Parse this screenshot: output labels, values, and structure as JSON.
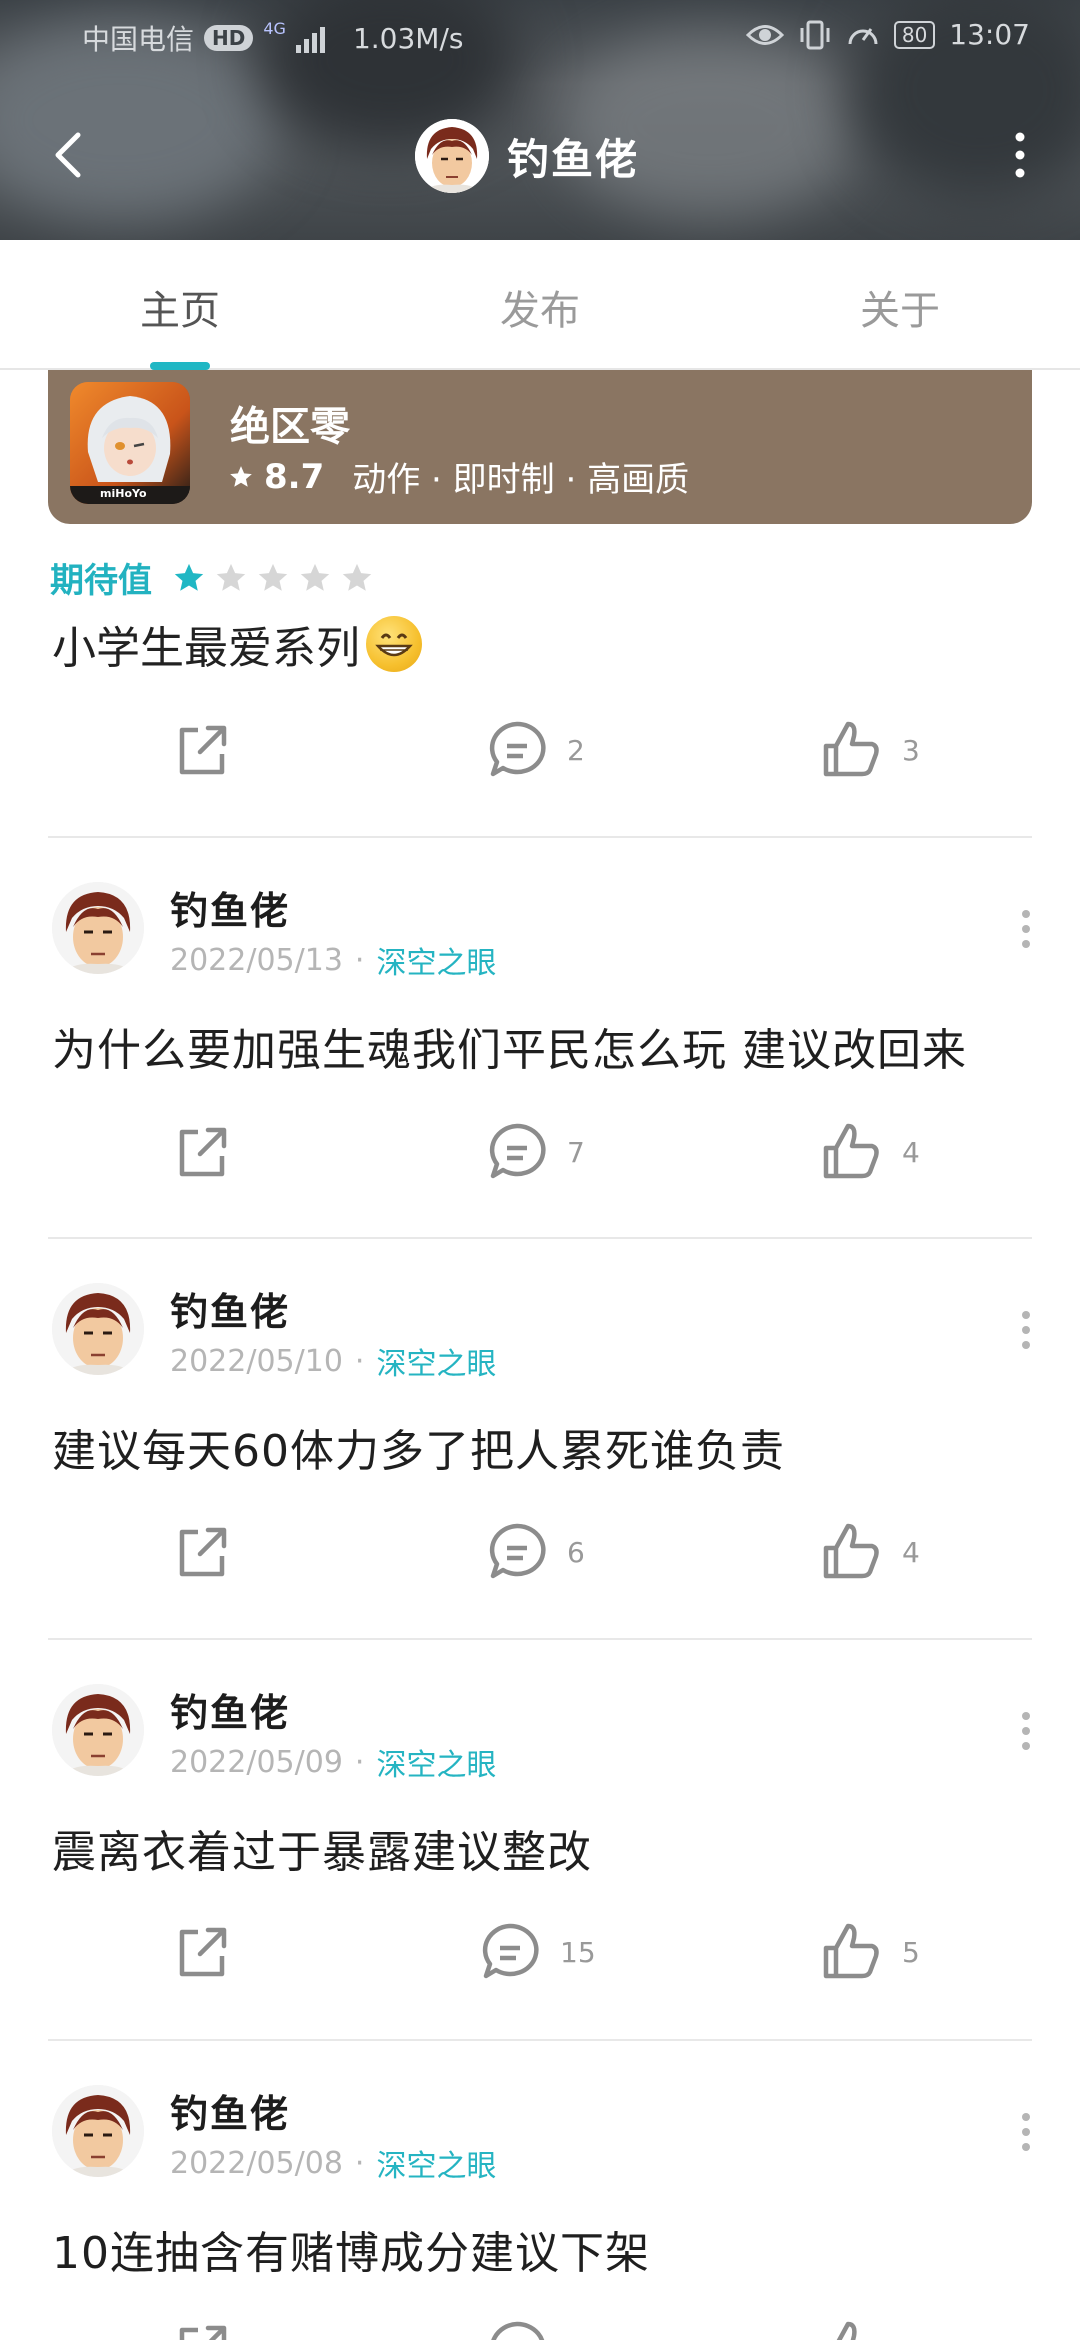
{
  "status_bar": {
    "carrier": "中国电信",
    "hd": "HD",
    "network": "4G",
    "speed": "1.03M/s",
    "battery": "80",
    "time": "13:07"
  },
  "header": {
    "title": "钓鱼佬"
  },
  "tabs": [
    {
      "label": "主页",
      "active": true
    },
    {
      "label": "发布",
      "active": false
    },
    {
      "label": "关于",
      "active": false
    }
  ],
  "game_card": {
    "name": "绝区零",
    "rating": "8.7",
    "tags": "动作 · 即时制 · 高画质",
    "icon_text": "miHoYo"
  },
  "review": {
    "expect_label": "期待值",
    "stars_filled": 1,
    "stars_total": 5,
    "text": "小学生最爱系列",
    "emoji": "grinning-face",
    "comments": "2",
    "likes": "3"
  },
  "posts": [
    {
      "author": "钓鱼佬",
      "date": "2022/05/13",
      "source": "深空之眼",
      "text": "为什么要加强生魂我们平民怎么玩 建议改回来",
      "comments": "7",
      "likes": "4"
    },
    {
      "author": "钓鱼佬",
      "date": "2022/05/10",
      "source": "深空之眼",
      "text": "建议每天60体力多了把人累死谁负责",
      "comments": "6",
      "likes": "4"
    },
    {
      "author": "钓鱼佬",
      "date": "2022/05/09",
      "source": "深空之眼",
      "text": "震离衣着过于暴露建议整改",
      "comments": "15",
      "likes": "5"
    },
    {
      "author": "钓鱼佬",
      "date": "2022/05/08",
      "source": "深空之眼",
      "text": "10连抽含有赌博成分建议下架",
      "comments": "",
      "likes": ""
    }
  ],
  "colors": {
    "accent": "#20b7c4",
    "card_bg": "#8a7562",
    "header_bg": "#4d5256"
  }
}
